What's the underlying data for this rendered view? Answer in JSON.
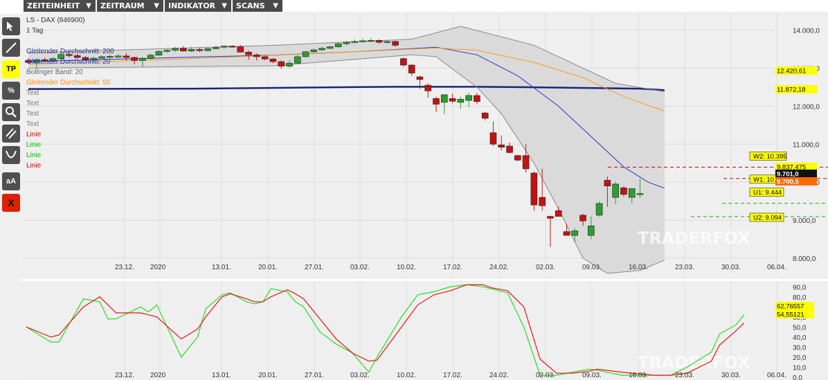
{
  "menu": [
    {
      "label": "ZEITEINHEIT"
    },
    {
      "label": "ZEITRAUM"
    },
    {
      "label": "INDIKATOR"
    },
    {
      "label": "SCANS"
    }
  ],
  "toolbar": {
    "tp_label": "TP",
    "percent_label": "%",
    "font_label": "aA",
    "delete_label": "X"
  },
  "header": {
    "instrument": "LS - DAX (846900)",
    "timeframe": "1 Tag"
  },
  "legend": [
    {
      "label": "Gleitender Durchschnitt: 200",
      "color": "#1a237e"
    },
    {
      "label": "Gleitender Durchschnitt: 20",
      "color": "#2233cc"
    },
    {
      "label": "Bollinger Band: 20",
      "color": "#666666"
    },
    {
      "label": "Gleitender Durchschnitt: 50",
      "color": "#ff8c00"
    },
    {
      "label": "Text",
      "color": "#777777"
    },
    {
      "label": "Text",
      "color": "#777777"
    },
    {
      "label": "Text",
      "color": "#777777"
    },
    {
      "label": "Text",
      "color": "#777777"
    },
    {
      "label": "Linie",
      "color": "#cc0000"
    },
    {
      "label": "Linie",
      "color": "#00bb00"
    },
    {
      "label": "Linie",
      "color": "#00bb00"
    },
    {
      "label": "Linie",
      "color": "#cc0000"
    }
  ],
  "watermark": "TRADERFOX",
  "price_labels": {
    "ma200": "12.420,61",
    "ma50": "11.872,18",
    "ma20": "9.837,475",
    "current": "9.701,0",
    "low": "9.700,5"
  },
  "lines": [
    {
      "label": "W2: 10.395",
      "value": 10395,
      "color": "#cc0000"
    },
    {
      "label": "W1: 10.097",
      "value": 10097,
      "color": "#cc0000"
    },
    {
      "label": "U1: 9.444",
      "value": 9444,
      "color": "#00bb00"
    },
    {
      "label": "U2: 9.094",
      "value": 9094,
      "color": "#00bb00"
    }
  ],
  "osc_labels": {
    "k": "62,76557",
    "d": "54,55121"
  },
  "colors": {
    "up": "#2e9e2e",
    "down": "#c41212",
    "ma200": "#1a237e",
    "ma20": "#2233cc",
    "ma50": "#ff9a1a",
    "osc_k": "#22dd22",
    "osc_d": "#ee1111"
  },
  "chart_data": {
    "type": "candlestick",
    "x_ticks": [
      "23.12.",
      "2020",
      "13.01.",
      "20.01.",
      "27.01.",
      "03.02.",
      "10.02.",
      "17.02.",
      "24.02.",
      "02.03.",
      "09.03.",
      "16.03.",
      "23.03.",
      "30.03.",
      "06.04."
    ],
    "y_ticks": [
      "14.000,0",
      "13.000,0",
      "12.000,0",
      "11.000,0",
      "10.000,0",
      "9.000,0",
      "8.000,0"
    ],
    "ylim": [
      7600,
      14300
    ],
    "candles": [
      {
        "o": 13200,
        "h": 13240,
        "l": 13120,
        "c": 13150
      },
      {
        "o": 13150,
        "h": 13250,
        "l": 13000,
        "c": 13220
      },
      {
        "o": 13220,
        "h": 13280,
        "l": 13160,
        "c": 13190
      },
      {
        "o": 13190,
        "h": 13290,
        "l": 13150,
        "c": 13250
      },
      {
        "o": 13250,
        "h": 13420,
        "l": 13220,
        "c": 13360
      },
      {
        "o": 13360,
        "h": 13400,
        "l": 13280,
        "c": 13330
      },
      {
        "o": 13330,
        "h": 13380,
        "l": 13240,
        "c": 13280
      },
      {
        "o": 13280,
        "h": 13320,
        "l": 13180,
        "c": 13220
      },
      {
        "o": 13220,
        "h": 13300,
        "l": 13170,
        "c": 13260
      },
      {
        "o": 13260,
        "h": 13340,
        "l": 13220,
        "c": 13300
      },
      {
        "o": 13300,
        "h": 13360,
        "l": 13250,
        "c": 13310
      },
      {
        "o": 13310,
        "h": 13370,
        "l": 13260,
        "c": 13320
      },
      {
        "o": 13320,
        "h": 13400,
        "l": 13200,
        "c": 13280
      },
      {
        "o": 13280,
        "h": 13300,
        "l": 13100,
        "c": 13200
      },
      {
        "o": 13200,
        "h": 13300,
        "l": 13040,
        "c": 13250
      },
      {
        "o": 13250,
        "h": 13380,
        "l": 13220,
        "c": 13340
      },
      {
        "o": 13340,
        "h": 13460,
        "l": 13320,
        "c": 13440
      },
      {
        "o": 13440,
        "h": 13500,
        "l": 13400,
        "c": 13470
      },
      {
        "o": 13470,
        "h": 13560,
        "l": 13420,
        "c": 13520
      },
      {
        "o": 13520,
        "h": 13580,
        "l": 13430,
        "c": 13450
      },
      {
        "o": 13450,
        "h": 13560,
        "l": 13420,
        "c": 13490
      },
      {
        "o": 13490,
        "h": 13540,
        "l": 13420,
        "c": 13460
      },
      {
        "o": 13460,
        "h": 13560,
        "l": 13430,
        "c": 13510
      },
      {
        "o": 13510,
        "h": 13590,
        "l": 13490,
        "c": 13550
      },
      {
        "o": 13550,
        "h": 13600,
        "l": 13510,
        "c": 13580
      },
      {
        "o": 13580,
        "h": 13600,
        "l": 13540,
        "c": 13560
      },
      {
        "o": 13560,
        "h": 13610,
        "l": 13430,
        "c": 13420
      },
      {
        "o": 13420,
        "h": 13460,
        "l": 13220,
        "c": 13350
      },
      {
        "o": 13350,
        "h": 13390,
        "l": 13200,
        "c": 13300
      },
      {
        "o": 13300,
        "h": 13330,
        "l": 13210,
        "c": 13240
      },
      {
        "o": 13240,
        "h": 13260,
        "l": 13130,
        "c": 13170
      },
      {
        "o": 13170,
        "h": 13200,
        "l": 12980,
        "c": 13050
      },
      {
        "o": 13050,
        "h": 13200,
        "l": 13000,
        "c": 13130
      },
      {
        "o": 13130,
        "h": 13350,
        "l": 13100,
        "c": 13300
      },
      {
        "o": 13300,
        "h": 13460,
        "l": 13270,
        "c": 13430
      },
      {
        "o": 13430,
        "h": 13520,
        "l": 13400,
        "c": 13480
      },
      {
        "o": 13480,
        "h": 13560,
        "l": 13450,
        "c": 13520
      },
      {
        "o": 13520,
        "h": 13590,
        "l": 13490,
        "c": 13560
      },
      {
        "o": 13560,
        "h": 13680,
        "l": 13540,
        "c": 13640
      },
      {
        "o": 13640,
        "h": 13720,
        "l": 13600,
        "c": 13680
      },
      {
        "o": 13680,
        "h": 13760,
        "l": 13660,
        "c": 13700
      },
      {
        "o": 13700,
        "h": 13780,
        "l": 13670,
        "c": 13720
      },
      {
        "o": 13720,
        "h": 13790,
        "l": 13680,
        "c": 13730
      },
      {
        "o": 13730,
        "h": 13760,
        "l": 13640,
        "c": 13680
      },
      {
        "o": 13680,
        "h": 13740,
        "l": 13650,
        "c": 13700
      },
      {
        "o": 13700,
        "h": 13720,
        "l": 13560,
        "c": 13600
      },
      {
        "o": 13250,
        "h": 13280,
        "l": 13040,
        "c": 13080
      },
      {
        "o": 13080,
        "h": 13100,
        "l": 12800,
        "c": 12870
      },
      {
        "o": 12770,
        "h": 12800,
        "l": 12450,
        "c": 12700
      },
      {
        "o": 12550,
        "h": 12600,
        "l": 12220,
        "c": 12400
      },
      {
        "o": 12200,
        "h": 12250,
        "l": 11850,
        "c": 12050
      },
      {
        "o": 12100,
        "h": 12300,
        "l": 11790,
        "c": 12300
      },
      {
        "o": 12200,
        "h": 12320,
        "l": 12080,
        "c": 12130
      },
      {
        "o": 12100,
        "h": 12250,
        "l": 11930,
        "c": 12180
      },
      {
        "o": 12150,
        "h": 12350,
        "l": 11980,
        "c": 12280
      },
      {
        "o": 12280,
        "h": 12350,
        "l": 12050,
        "c": 12120
      },
      {
        "o": 11820,
        "h": 11850,
        "l": 11620,
        "c": 11680
      },
      {
        "o": 11300,
        "h": 11600,
        "l": 10950,
        "c": 11000
      },
      {
        "o": 10980,
        "h": 11230,
        "l": 10840,
        "c": 10920
      },
      {
        "o": 10950,
        "h": 11040,
        "l": 10750,
        "c": 10780
      },
      {
        "o": 10700,
        "h": 10720,
        "l": 10550,
        "c": 10580
      },
      {
        "o": 10700,
        "h": 11000,
        "l": 10250,
        "c": 10350
      },
      {
        "o": 10240,
        "h": 10280,
        "l": 9250,
        "c": 9400
      },
      {
        "o": 9600,
        "h": 10350,
        "l": 9250,
        "c": 9380
      },
      {
        "o": 9100,
        "h": 9120,
        "l": 8300,
        "c": 9050
      },
      {
        "o": 9250,
        "h": 9350,
        "l": 9100,
        "c": 9100
      },
      {
        "o": 8700,
        "h": 8900,
        "l": 8600,
        "c": 8600
      },
      {
        "o": 8600,
        "h": 8790,
        "l": 8420,
        "c": 8720
      },
      {
        "o": 9130,
        "h": 9170,
        "l": 8850,
        "c": 8980
      },
      {
        "o": 8600,
        "h": 9100,
        "l": 8500,
        "c": 8850
      },
      {
        "o": 9130,
        "h": 9500,
        "l": 9090,
        "c": 9440
      },
      {
        "o": 10050,
        "h": 10150,
        "l": 9350,
        "c": 9900
      },
      {
        "o": 9600,
        "h": 10010,
        "l": 9420,
        "c": 9950
      },
      {
        "o": 9850,
        "h": 9900,
        "l": 9620,
        "c": 9680
      },
      {
        "o": 9600,
        "h": 9830,
        "l": 9450,
        "c": 9830
      },
      {
        "o": 9700,
        "h": 10090,
        "l": 9590,
        "c": 9701
      }
    ],
    "series": [
      {
        "name": "Gleitender Durchschnitt: 200",
        "values": [
          [
            0,
            12450
          ],
          [
            20,
            12460
          ],
          [
            35,
            12490
          ],
          [
            45,
            12510
          ],
          [
            55,
            12510
          ],
          [
            60,
            12500
          ],
          [
            75,
            12460
          ],
          [
            78,
            12420
          ]
        ]
      },
      {
        "name": "Gleitender Durchschnitt: 20",
        "values": [
          [
            0,
            13170
          ],
          [
            10,
            13230
          ],
          [
            20,
            13290
          ],
          [
            30,
            13340
          ],
          [
            40,
            13430
          ],
          [
            50,
            13550
          ],
          [
            55,
            13350
          ],
          [
            60,
            12800
          ],
          [
            65,
            12000
          ],
          [
            70,
            11000
          ],
          [
            73,
            10400
          ],
          [
            76,
            10000
          ],
          [
            78,
            9840
          ]
        ]
      },
      {
        "name": "Gleitender Durchschnitt: 50",
        "values": [
          [
            0,
            13100
          ],
          [
            20,
            13250
          ],
          [
            35,
            13380
          ],
          [
            45,
            13480
          ],
          [
            50,
            13530
          ],
          [
            55,
            13470
          ],
          [
            62,
            13150
          ],
          [
            68,
            12750
          ],
          [
            73,
            12250
          ],
          [
            78,
            11870
          ]
        ]
      },
      {
        "name": "Bollinger Band: 20",
        "values": [
          [
            0,
            13400
          ],
          [
            30,
            13600
          ],
          [
            47,
            13760
          ],
          [
            53,
            14100
          ],
          [
            62,
            13600
          ],
          [
            72,
            12600
          ],
          [
            78,
            12380
          ]
        ]
      },
      {
        "name": "Bollinger Band: 20",
        "values": [
          [
            0,
            13000
          ],
          [
            30,
            13060
          ],
          [
            47,
            13350
          ],
          [
            50,
            13300
          ],
          [
            55,
            12500
          ],
          [
            58,
            11800
          ],
          [
            62,
            10500
          ],
          [
            65,
            9300
          ],
          [
            68,
            8000
          ],
          [
            71,
            7600
          ],
          [
            75,
            7680
          ],
          [
            78,
            7950
          ]
        ]
      }
    ],
    "oscillator": {
      "y_ticks": [
        "90,0",
        "80,0",
        "70,0",
        "60,0",
        "50,0",
        "40,0",
        "30,0",
        "20,0",
        "10,0",
        "0,0"
      ],
      "ylim": [
        0,
        95
      ],
      "k": [
        [
          0,
          50
        ],
        [
          3,
          35
        ],
        [
          4,
          35
        ],
        [
          7,
          78
        ],
        [
          9,
          75
        ],
        [
          10,
          58
        ],
        [
          11,
          58
        ],
        [
          14,
          70
        ],
        [
          15,
          65
        ],
        [
          16,
          72
        ],
        [
          19,
          20
        ],
        [
          21,
          40
        ],
        [
          22,
          68
        ],
        [
          24,
          82
        ],
        [
          25,
          84
        ],
        [
          27,
          75
        ],
        [
          28,
          73
        ],
        [
          29,
          75
        ],
        [
          30,
          88
        ],
        [
          32,
          85
        ],
        [
          33,
          75
        ],
        [
          34,
          70
        ],
        [
          36,
          45
        ],
        [
          38,
          33
        ],
        [
          40,
          24
        ],
        [
          42,
          5
        ],
        [
          43,
          20
        ],
        [
          46,
          60
        ],
        [
          48,
          82
        ],
        [
          50,
          85
        ],
        [
          52,
          90
        ],
        [
          54,
          92
        ],
        [
          56,
          90
        ],
        [
          57,
          88
        ],
        [
          59,
          84
        ],
        [
          61,
          50
        ],
        [
          63,
          2
        ],
        [
          65,
          2
        ],
        [
          67,
          5
        ],
        [
          69,
          8
        ],
        [
          70,
          7
        ],
        [
          73,
          2
        ],
        [
          77,
          2
        ],
        [
          79,
          2
        ],
        [
          81,
          10
        ],
        [
          84,
          25
        ],
        [
          85,
          43
        ],
        [
          87,
          52
        ],
        [
          88,
          62
        ]
      ],
      "d": [
        [
          0,
          50
        ],
        [
          3,
          40
        ],
        [
          4,
          42
        ],
        [
          7,
          70
        ],
        [
          9,
          80
        ],
        [
          10,
          72
        ],
        [
          11,
          64
        ],
        [
          14,
          64
        ],
        [
          15,
          62
        ],
        [
          16,
          60
        ],
        [
          19,
          38
        ],
        [
          21,
          48
        ],
        [
          22,
          60
        ],
        [
          24,
          80
        ],
        [
          25,
          83
        ],
        [
          27,
          78
        ],
        [
          28,
          75
        ],
        [
          29,
          75
        ],
        [
          30,
          80
        ],
        [
          32,
          87
        ],
        [
          33,
          83
        ],
        [
          34,
          78
        ],
        [
          36,
          58
        ],
        [
          38,
          38
        ],
        [
          40,
          24
        ],
        [
          42,
          16
        ],
        [
          43,
          17
        ],
        [
          46,
          50
        ],
        [
          48,
          72
        ],
        [
          50,
          82
        ],
        [
          52,
          86
        ],
        [
          54,
          92
        ],
        [
          56,
          92
        ],
        [
          57,
          89
        ],
        [
          59,
          86
        ],
        [
          61,
          70
        ],
        [
          63,
          18
        ],
        [
          65,
          4
        ],
        [
          67,
          4
        ],
        [
          69,
          6
        ],
        [
          70,
          8
        ],
        [
          73,
          5
        ],
        [
          77,
          2
        ],
        [
          79,
          2
        ],
        [
          81,
          4
        ],
        [
          84,
          16
        ],
        [
          85,
          32
        ],
        [
          87,
          46
        ],
        [
          88,
          54
        ]
      ]
    }
  }
}
